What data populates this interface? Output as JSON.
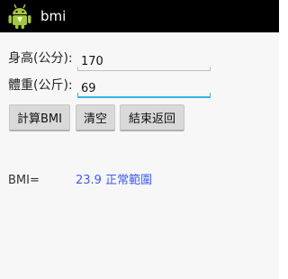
{
  "app": {
    "title": "bmi",
    "icon": "android-robot-icon"
  },
  "form": {
    "height_label": "身高(公分):",
    "height_value": "170",
    "weight_label": "體重(公斤):",
    "weight_value": "69"
  },
  "buttons": {
    "calc_label": "計算BMI",
    "clear_label": "清空",
    "exit_label": "結束返回"
  },
  "result": {
    "label": "BMI=",
    "value": "23.9  正常範圍"
  },
  "colors": {
    "actionbar": "#000000",
    "android_green": "#a4c639",
    "focus_underline": "#33b5e5",
    "result_text": "#3d5afe"
  }
}
